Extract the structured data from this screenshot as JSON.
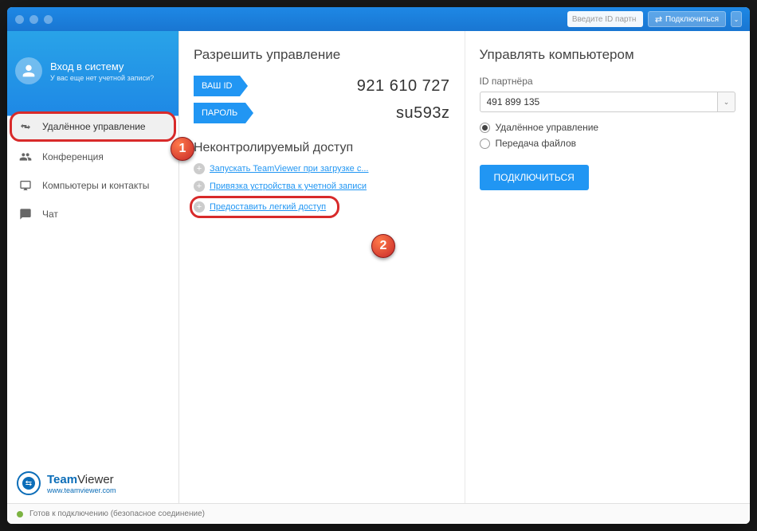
{
  "titlebar": {
    "partner_placeholder": "Введите ID партн",
    "connect_label": "Подключиться"
  },
  "profile": {
    "title": "Вход в систему",
    "subtitle": "У вас еще нет учетной записи?"
  },
  "nav": [
    {
      "key": "remote",
      "label": "Удалённое управление",
      "active": true,
      "highlighted": true
    },
    {
      "key": "meeting",
      "label": "Конференция",
      "active": false
    },
    {
      "key": "computers",
      "label": "Компьютеры и контакты",
      "active": false
    },
    {
      "key": "chat",
      "label": "Чат",
      "active": false
    }
  ],
  "logo": {
    "name_black": "Viewer",
    "name_blue": "Team",
    "url": "www.teamviewer.com"
  },
  "left_panel": {
    "title": "Разрешить управление",
    "id_tag": "ВАШ ID",
    "id_value": "921 610 727",
    "pw_tag": "ПАРОЛЬ",
    "pw_value": "su593z",
    "ua_title": "Неконтролируемый доступ",
    "links": [
      {
        "text": "Запускать TeamViewer при загрузке с...",
        "highlighted": false
      },
      {
        "text": "Привязка устройства к учетной записи",
        "highlighted": false
      },
      {
        "text": "Предоставить легкий доступ",
        "highlighted": true
      }
    ]
  },
  "right_panel": {
    "title": "Управлять компьютером",
    "partner_label": "ID партнёра",
    "partner_value": "491 899 135",
    "radios": [
      {
        "label": "Удалённое управление",
        "checked": true
      },
      {
        "label": "Передача файлов",
        "checked": false
      }
    ],
    "connect_label": "ПОДКЛЮЧИТЬСЯ"
  },
  "status": {
    "text": "Готов к подключению (безопасное соединение)"
  },
  "annotations": {
    "badge1": "1",
    "badge2": "2"
  }
}
